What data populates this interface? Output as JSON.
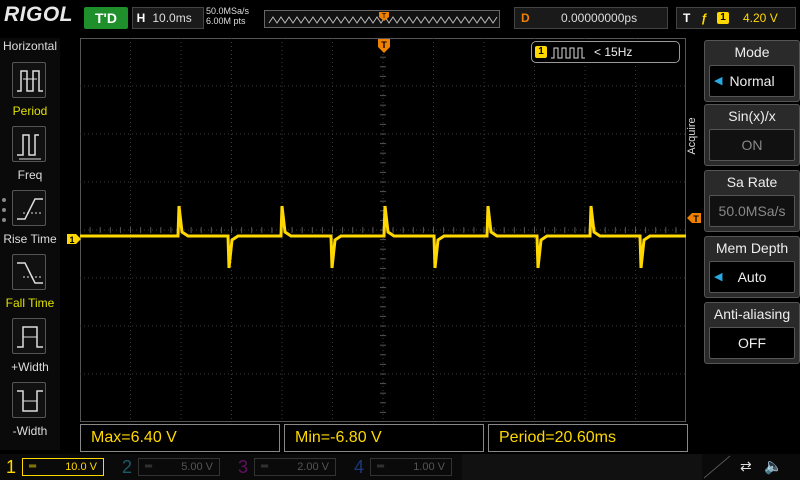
{
  "brand": "RIGOL",
  "top": {
    "run_status": "T'D",
    "timebase_tag": "H",
    "timebase": "10.0ms",
    "sample_rate": "50.0MSa/s",
    "mem_points": "6.00M pts",
    "delay_tag": "D",
    "delay": "0.00000000ps",
    "trigger_tag": "T",
    "trigger_edge": "ƒ",
    "trigger_source": "1",
    "trigger_level": "4.20 V"
  },
  "left_menu": {
    "title": "Horizontal",
    "items": [
      {
        "label": "Period",
        "icon": "period-icon"
      },
      {
        "label": "Freq",
        "icon": "freq-icon"
      },
      {
        "label": "Rise Time",
        "icon": "rise-time-icon"
      },
      {
        "label": "Fall Time",
        "icon": "fall-time-icon"
      },
      {
        "label": "+Width",
        "icon": "pos-width-icon"
      },
      {
        "label": "-Width",
        "icon": "neg-width-icon"
      }
    ]
  },
  "right_menu": {
    "section": "Acquire",
    "items": [
      {
        "title": "Mode",
        "value": "Normal",
        "active": true
      },
      {
        "title": "Sin(x)/x",
        "value": "ON",
        "active": false
      },
      {
        "title": "Sa Rate",
        "value": "50.0MSa/s",
        "active": false
      },
      {
        "title": "Mem Depth",
        "value": "Auto",
        "active": true
      },
      {
        "title": "Anti-aliasing",
        "value": "OFF",
        "active": false
      }
    ]
  },
  "freq_counter": {
    "channel": "1",
    "value": "< 15Hz"
  },
  "markers": {
    "trigger_pos": "T",
    "channel1": "1"
  },
  "measurements": [
    {
      "text": "Max=6.40 V"
    },
    {
      "text": "Min=-6.80 V"
    },
    {
      "text": "Period=20.60ms"
    }
  ],
  "channels": [
    {
      "num": "1",
      "coupling": "═",
      "scale": "10.0 V",
      "color": "#ffd800",
      "active": true
    },
    {
      "num": "2",
      "coupling": "═",
      "scale": "5.00 V",
      "color": "#1aa8c8",
      "active": false
    },
    {
      "num": "3",
      "coupling": "═",
      "scale": "2.00 V",
      "color": "#c020c0",
      "active": false
    },
    {
      "num": "4",
      "coupling": "═",
      "scale": "1.00 V",
      "color": "#2a5ac8",
      "active": false
    }
  ],
  "colors": {
    "ch1": "#ffd800",
    "grid": "#3a3a3a",
    "trigger": "#f08000"
  }
}
